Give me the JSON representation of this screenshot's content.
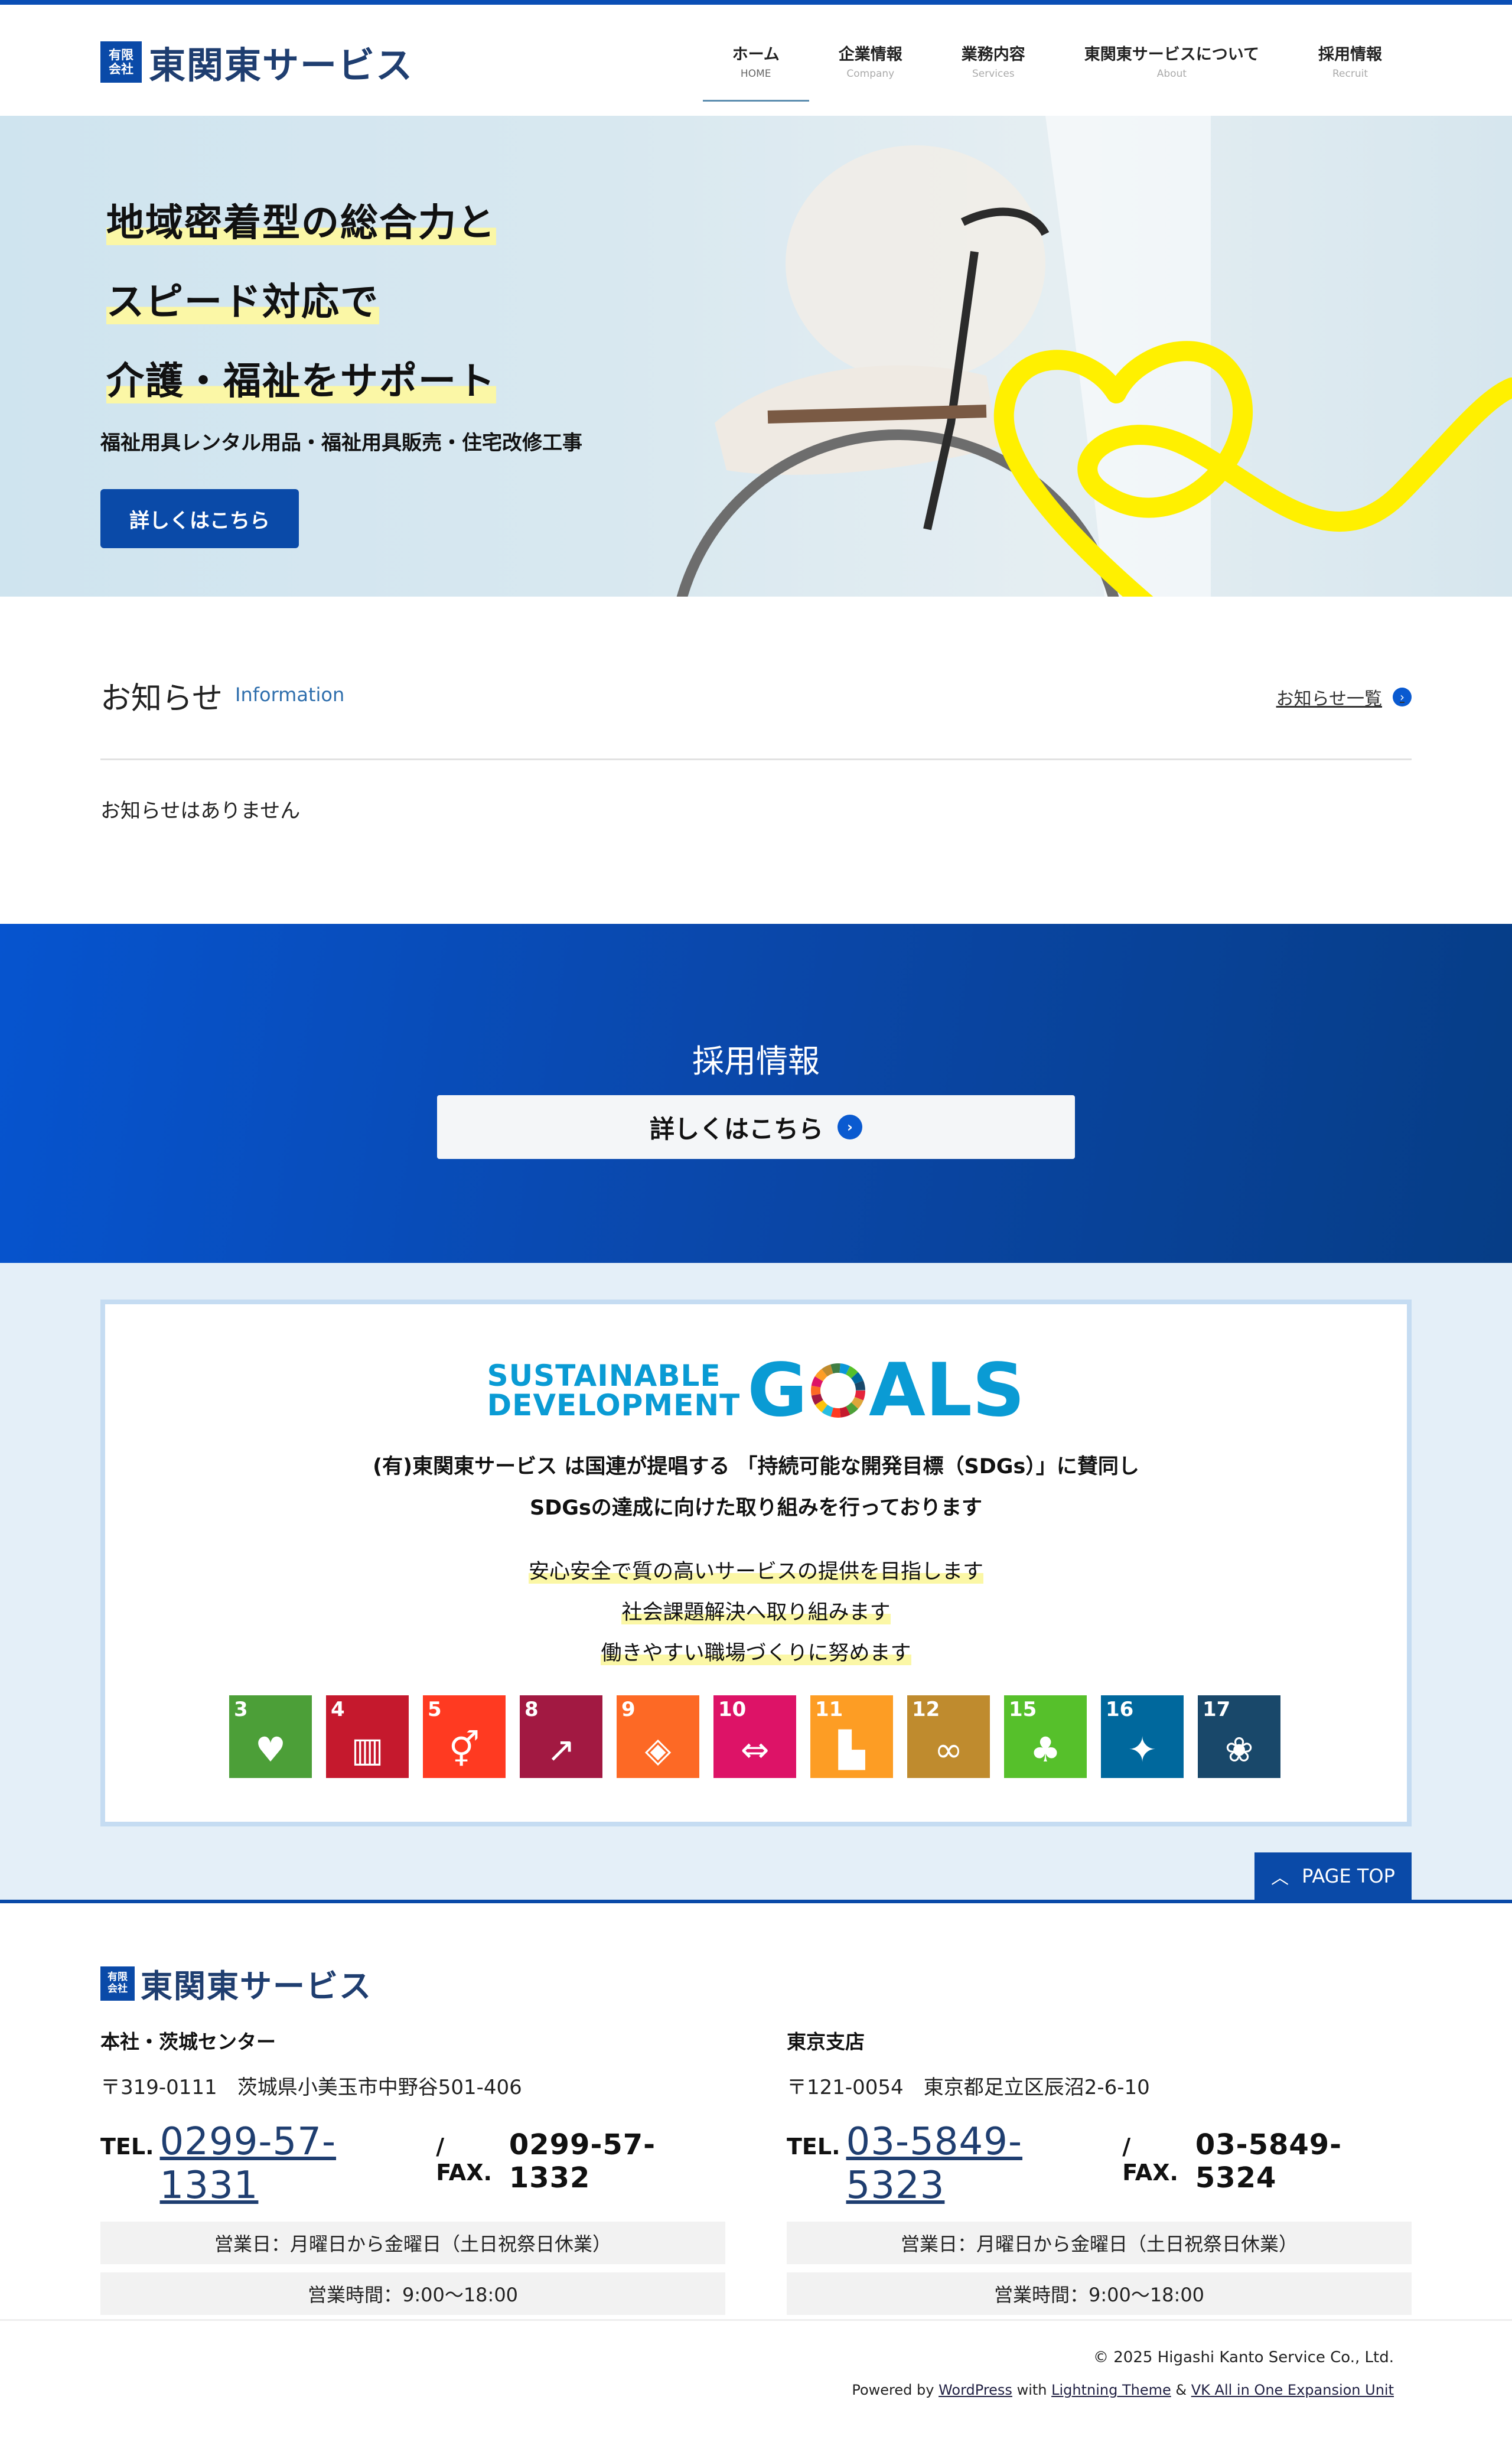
{
  "header": {
    "logo_badge_line1": "有限",
    "logo_badge_line2": "会社",
    "logo_name": "東関東サービス",
    "nav": [
      {
        "label": "ホーム",
        "sub": "HOME",
        "active": true
      },
      {
        "label": "企業情報",
        "sub": "Company"
      },
      {
        "label": "業務内容",
        "sub": "Services"
      },
      {
        "label": "東関東サービスについて",
        "sub": "About"
      },
      {
        "label": "採用情報",
        "sub": "Recruit"
      }
    ]
  },
  "hero": {
    "lines": [
      "地域密着型の総合力と",
      "スピード対応で",
      "介護・福祉をサポート"
    ],
    "subtitle": "福祉用具レンタル用品・福祉用具販売・住宅改修工事",
    "button": "詳しくはこちら"
  },
  "news": {
    "title": "お知らせ",
    "subtitle": "Information",
    "link": "お知らせ一覧",
    "empty": "お知らせはありません"
  },
  "recruit": {
    "title": "採用情報",
    "button": "詳しくはこちら"
  },
  "sdgs": {
    "logo_line1": "SUSTAINABLE",
    "logo_line2": "DEVELOPMENT",
    "logo_goals_g": "G",
    "logo_goals_rest": "ALS",
    "statement_line1": "(有)東関東サービス は国連が提唱する 「持続可能な開発目標（SDGs）」に賛同し",
    "statement_line2": "SDGsの達成に向けた取り組みを行っております",
    "points": [
      "安心安全で質の高いサービスの提供を目指します",
      "社会課題解決へ取り組みます",
      "働きやすい職場づくりに努めます"
    ],
    "goals": [
      {
        "num": "3",
        "color": "#4c9f38",
        "icon": "heartbeat-icon",
        "glyph": "♥"
      },
      {
        "num": "4",
        "color": "#c5192d",
        "icon": "book-icon",
        "glyph": "▥"
      },
      {
        "num": "5",
        "color": "#ff3a21",
        "icon": "gender-icon",
        "glyph": "⚥"
      },
      {
        "num": "8",
        "color": "#a21942",
        "icon": "growth-chart-icon",
        "glyph": "↗"
      },
      {
        "num": "9",
        "color": "#fd6925",
        "icon": "cubes-icon",
        "glyph": "◈"
      },
      {
        "num": "10",
        "color": "#dd1367",
        "icon": "equality-icon",
        "glyph": "⇔"
      },
      {
        "num": "11",
        "color": "#fd9d24",
        "icon": "city-icon",
        "glyph": "▙"
      },
      {
        "num": "12",
        "color": "#bf8b2e",
        "icon": "infinity-icon",
        "glyph": "∞"
      },
      {
        "num": "15",
        "color": "#56c02b",
        "icon": "tree-icon",
        "glyph": "♣"
      },
      {
        "num": "16",
        "color": "#00689d",
        "icon": "dove-icon",
        "glyph": "✦"
      },
      {
        "num": "17",
        "color": "#19486a",
        "icon": "flower-icon",
        "glyph": "❀"
      }
    ]
  },
  "page_top": "PAGE TOP",
  "footer": {
    "offices": [
      {
        "name": "本社・茨城センター",
        "address": "〒319-0111　茨城県小美玉市中野谷501-406",
        "tel_label": "TEL.",
        "tel": "0299-57-1331",
        "fax_label": "/ FAX.",
        "fax": "0299-57-1332",
        "days": "営業日：月曜日から金曜日（土日祝祭日休業）",
        "hours": "営業時間：9:00〜18:00"
      },
      {
        "name": "東京支店",
        "address": "〒121-0054　東京都足立区辰沼2-6-10",
        "tel_label": "TEL.",
        "tel": "03-5849-5323",
        "fax_label": "/ FAX.",
        "fax": "03-5849-5324",
        "days": "営業日：月曜日から金曜日（土日祝祭日休業）",
        "hours": "営業時間：9:00〜18:00"
      }
    ],
    "copyright": "© 2025 Higashi Kanto Service Co., Ltd.",
    "powered_prefix": "Powered by ",
    "powered_wp": "WordPress",
    "powered_with": " with ",
    "powered_theme": "Lightning Theme",
    "powered_amp": " & ",
    "powered_unit": "VK All in One Expansion Unit"
  },
  "colors": {
    "brand_blue": "#0a4aa8",
    "highlight_yellow": "#fbf7a6",
    "sdg_blue": "#0a9bd4"
  }
}
